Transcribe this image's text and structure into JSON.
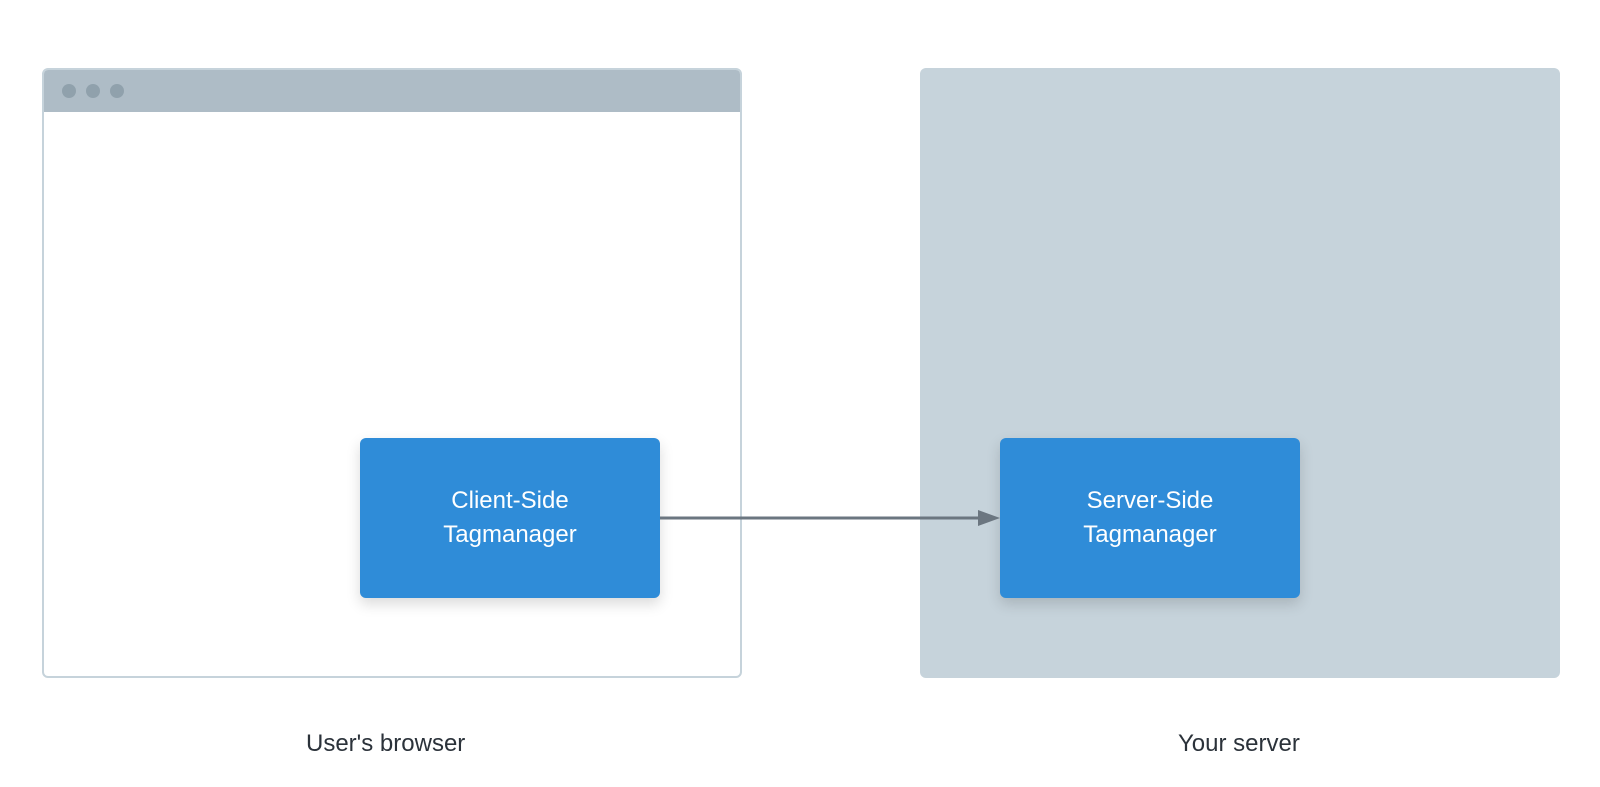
{
  "browser": {
    "caption": "User's browser",
    "client_tag": {
      "line1": "Client-Side",
      "line2": "Tagmanager"
    }
  },
  "server": {
    "caption": "Your server",
    "server_tag": {
      "line1": "Server-Side",
      "line2": "Tagmanager"
    }
  },
  "colors": {
    "tag_box_bg": "#2f8cd8",
    "server_panel_bg": "#c6d3db",
    "titlebar_bg": "#aebcc6",
    "traffic_light": "#90a1ac",
    "arrow": "#6b7680",
    "caption_text": "#2b323a"
  }
}
